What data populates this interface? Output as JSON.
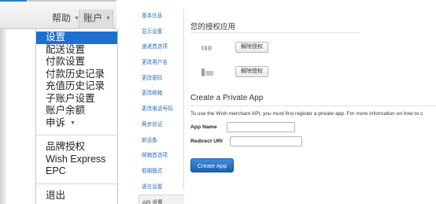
{
  "top_nav": {
    "help_label": "帮助",
    "account_label": "账户"
  },
  "account_menu": {
    "items": [
      {
        "label": "设置",
        "active": true
      },
      {
        "label": "配送设置"
      },
      {
        "label": "付款设置"
      },
      {
        "label": "付款历史记录"
      },
      {
        "label": "充值历史记录"
      },
      {
        "label": "子账户设置"
      },
      {
        "label": "账户余额"
      },
      {
        "label": "申诉",
        "has_submenu": true
      }
    ],
    "items_secondary": [
      {
        "label": "品牌授权"
      },
      {
        "label": "Wish Express"
      },
      {
        "label": "EPC"
      }
    ],
    "logout_label": "退出"
  },
  "settings_nav": {
    "items": [
      {
        "label": "基本信息"
      },
      {
        "label": "显示设置"
      },
      {
        "label": "速递首选项"
      },
      {
        "label": "更改用户名"
      },
      {
        "label": "更改密码"
      },
      {
        "label": "更改邮箱"
      },
      {
        "label": "更改电话号码"
      },
      {
        "label": "两步验证"
      },
      {
        "label": "新设备"
      },
      {
        "label": "邮箱首选项"
      },
      {
        "label": "假期模式"
      },
      {
        "label": "语言设置"
      },
      {
        "label": "API 设置",
        "active": true
      }
    ]
  },
  "authorized_apps": {
    "title": "您的授权应用",
    "apps": [
      {
        "revoke_label": "解除授权"
      },
      {
        "revoke_label": "解除授权"
      }
    ]
  },
  "private_app": {
    "title": "Create a Private App",
    "intro": "To use the Wish merchant API, you must first register a private app. For more information on how to c",
    "app_name_label": "App Name",
    "app_name_value": "",
    "redirect_uri_label": "Redirect URI",
    "redirect_uri_value": "",
    "create_button_label": "Create App"
  },
  "colors": {
    "accent": "#1f6fd1",
    "link": "#2b6cb0",
    "create_button": "#2a74c9"
  }
}
